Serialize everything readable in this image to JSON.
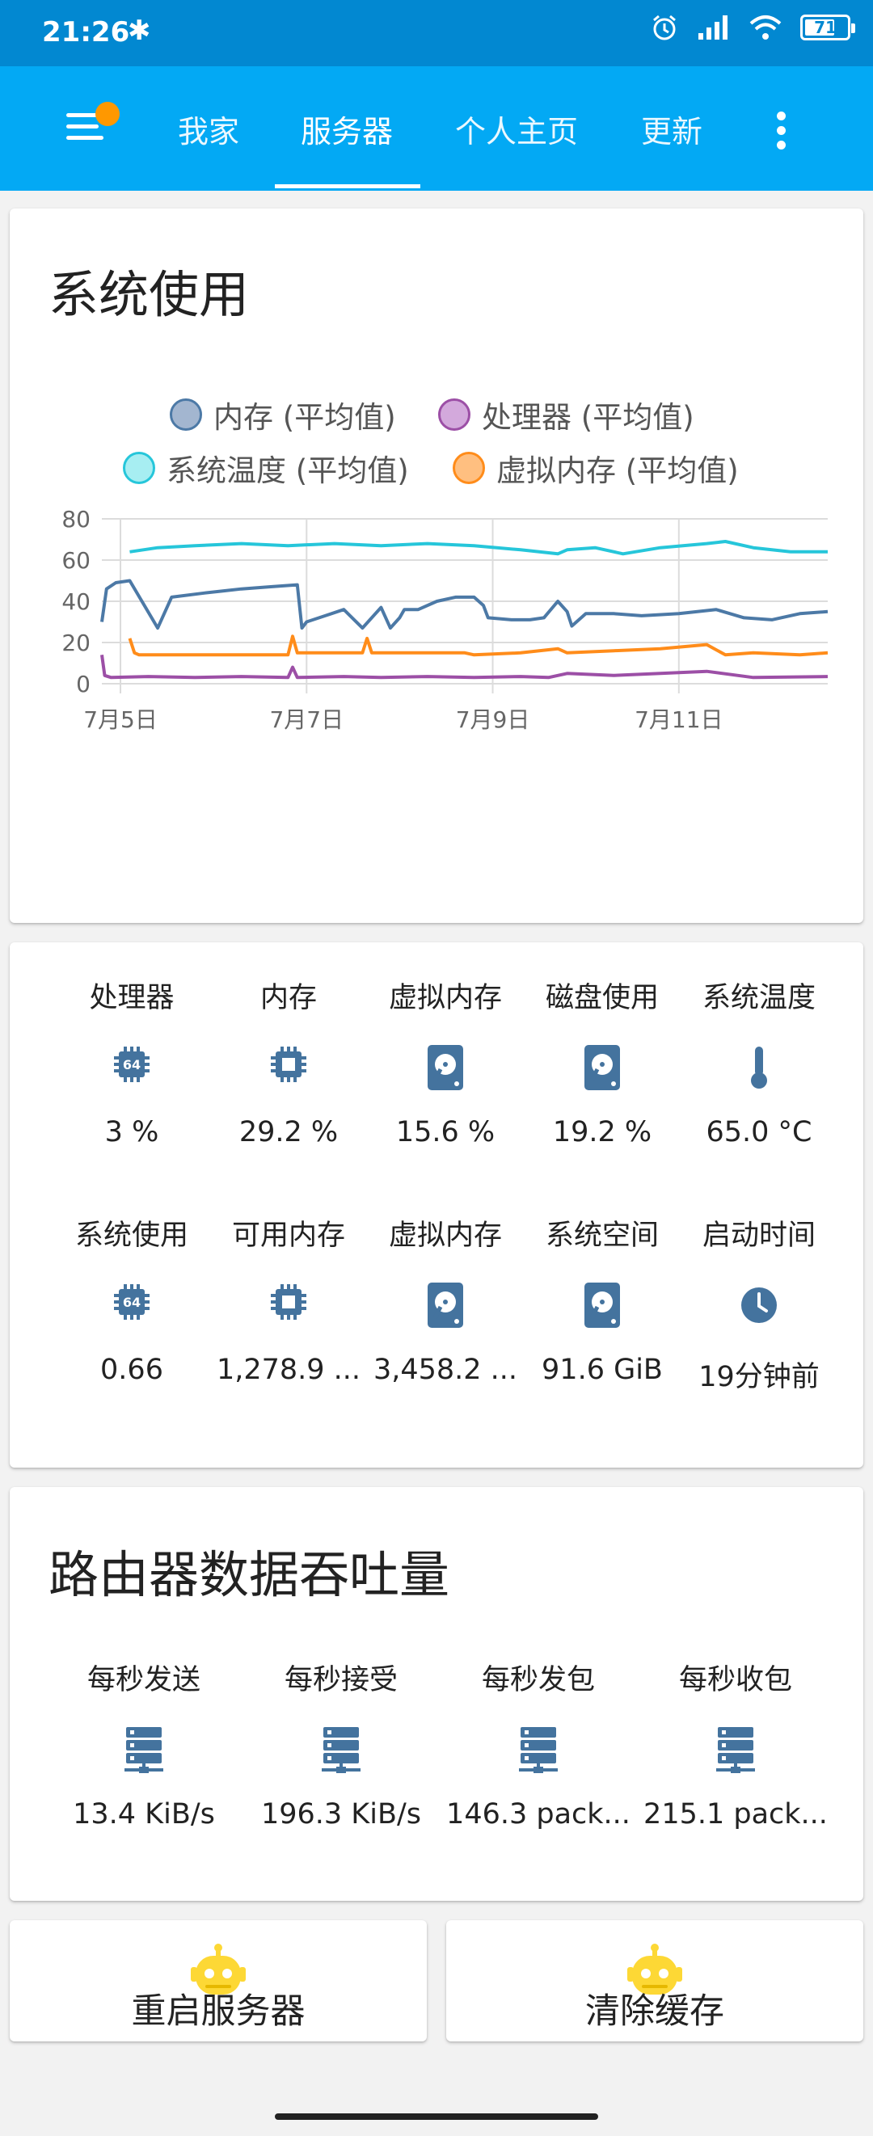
{
  "status_bar": {
    "time": "21:26",
    "battery": "71",
    "battery_level": 0.71
  },
  "nav": {
    "tabs": [
      "我家",
      "服务器",
      "个人主页",
      "更新"
    ],
    "active_tab": "服务器"
  },
  "system_card": {
    "title": "系统使用",
    "legend": [
      "内存 (平均值)",
      "处理器 (平均值)",
      "系统温度 (平均值)",
      "虚拟内存 (平均值)"
    ]
  },
  "chart_data": {
    "type": "line",
    "title": "",
    "xlabel": "",
    "ylabel": "",
    "ylim": [
      0,
      80
    ],
    "yticks": [
      "0",
      "20",
      "40",
      "60",
      "80"
    ],
    "xticks": [
      "7月5日",
      "7月7日",
      "7月9日",
      "7月11日"
    ],
    "xlim": [
      "7月4日 19:00",
      "7月12日 14:00"
    ],
    "grid": true,
    "legend_position": "top",
    "series": [
      {
        "name": "内存 (平均值)",
        "color": "#4c79a6",
        "x": [
          0.0,
          0.05,
          0.15,
          0.3,
          0.6,
          0.75,
          1.1,
          1.3,
          1.5,
          1.8,
          2.1,
          2.15,
          2.2,
          2.4,
          2.6,
          2.8,
          3.0,
          3.1,
          3.2,
          3.25,
          3.4,
          3.6,
          3.8,
          4.0,
          4.1,
          4.15,
          4.4,
          4.6,
          4.75,
          4.9,
          5.0,
          5.05,
          5.2,
          5.5,
          5.8,
          6.2,
          6.6,
          6.9,
          7.2,
          7.5,
          7.8
        ],
        "y": [
          30,
          46,
          49,
          50,
          27,
          42,
          44,
          45,
          46,
          47,
          48,
          27,
          30,
          33,
          36,
          27,
          37,
          27,
          32,
          36,
          36,
          40,
          42,
          42,
          38,
          32,
          31,
          31,
          32,
          40,
          35,
          28,
          34,
          34,
          33,
          34,
          36,
          32,
          31,
          34,
          35
        ]
      },
      {
        "name": "处理器 (平均值)",
        "color": "#9c4fa6",
        "x": [
          0.0,
          0.03,
          0.1,
          0.5,
          1.0,
          1.5,
          2.0,
          2.05,
          2.1,
          2.6,
          3.0,
          3.5,
          4.0,
          4.5,
          4.8,
          5.0,
          5.5,
          6.0,
          6.5,
          7.0,
          7.8
        ],
        "y": [
          14,
          4,
          3,
          3.5,
          3,
          3.5,
          3,
          8,
          3,
          3.5,
          3,
          3.5,
          3,
          3.5,
          3,
          5,
          4,
          5,
          6,
          3,
          3.5
        ]
      },
      {
        "name": "系统温度 (平均值)",
        "color": "#26c6da",
        "x": [
          0.3,
          0.6,
          1.0,
          1.5,
          2.0,
          2.5,
          3.0,
          3.5,
          4.0,
          4.5,
          4.9,
          5.0,
          5.3,
          5.6,
          6.0,
          6.5,
          6.7,
          7.0,
          7.4,
          7.8
        ],
        "y": [
          64,
          66,
          67,
          68,
          67,
          68,
          67,
          68,
          67,
          65,
          63,
          65,
          66,
          63,
          66,
          68,
          69,
          66,
          64,
          64
        ]
      },
      {
        "name": "虚拟内存 (平均值)",
        "color": "#ff8c1a",
        "x": [
          0.3,
          0.35,
          0.4,
          1.0,
          1.5,
          2.0,
          2.05,
          2.1,
          2.8,
          2.85,
          2.9,
          3.5,
          3.9,
          4.0,
          4.5,
          4.9,
          5.0,
          5.5,
          6.0,
          6.5,
          6.7,
          7.0,
          7.5,
          7.8
        ],
        "y": [
          22,
          15,
          14,
          14,
          14,
          14,
          23,
          15,
          15,
          22,
          15,
          15,
          15,
          14,
          15,
          17,
          15,
          16,
          17,
          19,
          14,
          15,
          14,
          15
        ]
      }
    ]
  },
  "stats_grid": {
    "items": [
      {
        "label": "处理器",
        "icon": "cpu-64-icon",
        "value": "3 %"
      },
      {
        "label": "内存",
        "icon": "memory-chip-icon",
        "value": "29.2 %"
      },
      {
        "label": "虚拟内存",
        "icon": "harddisk-icon",
        "value": "15.6 %"
      },
      {
        "label": "磁盘使用",
        "icon": "harddisk-icon",
        "value": "19.2 %"
      },
      {
        "label": "系统温度",
        "icon": "thermometer-icon",
        "value": "65.0 °C"
      },
      {
        "label": "系统使用",
        "icon": "cpu-64-icon",
        "value": "0.66"
      },
      {
        "label": "可用内存",
        "icon": "memory-chip-icon",
        "value": "1,278.9 ..."
      },
      {
        "label": "虚拟内存",
        "icon": "harddisk-icon",
        "value": "3,458.2 ..."
      },
      {
        "label": "系统空间",
        "icon": "harddisk-icon",
        "value": "91.6 GiB"
      },
      {
        "label": "启动时间",
        "icon": "clock-icon",
        "value": "19分钟前"
      }
    ],
    "icon_color": "#44739e"
  },
  "router_card": {
    "title": "路由器数据吞吐量",
    "items": [
      {
        "label": "每秒发送",
        "value": "13.4 KiB/s",
        "icon": "server-network-icon"
      },
      {
        "label": "每秒接受",
        "value": "196.3 KiB/s",
        "icon": "server-network-icon"
      },
      {
        "label": "每秒发包",
        "value": "146.3 pack...",
        "icon": "server-network-icon"
      },
      {
        "label": "每秒收包",
        "value": "215.1 pack...",
        "icon": "server-network-icon"
      }
    ]
  },
  "actions": [
    {
      "label": "重启服务器",
      "icon": "robot-icon"
    },
    {
      "label": "清除缓存",
      "icon": "robot-icon"
    }
  ],
  "colors": {
    "status_bar": "#0288d1",
    "header": "#03a9f4",
    "badge": "#ff9800",
    "robot": "#fdd835"
  }
}
